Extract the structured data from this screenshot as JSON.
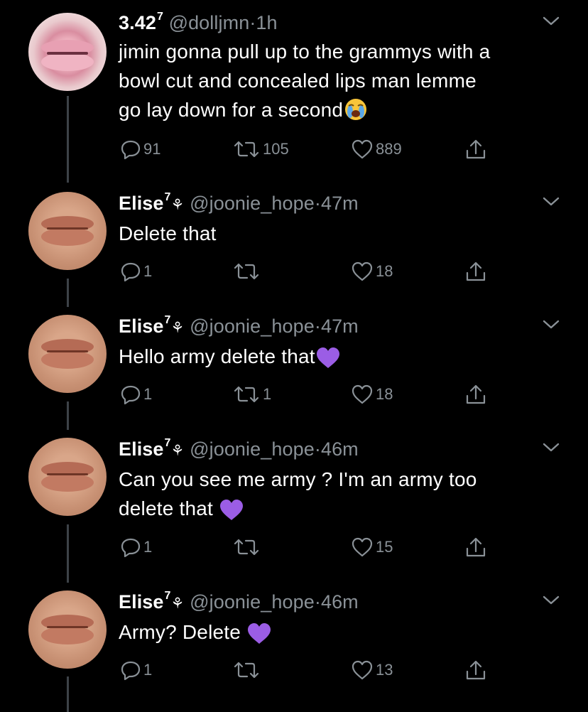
{
  "tweets": [
    {
      "name": "3.42",
      "sup": "7",
      "handle": "@dolljmn",
      "dot": "·",
      "time": "1h",
      "lines": [
        "jimin gonna pull up to the grammys with a",
        "bowl cut and concealed lips man lemme",
        "go lay down for a second"
      ],
      "trailing_emoji": "crying-face-emoji",
      "replies": "91",
      "retweets": "105",
      "likes": "889",
      "avatar": "pink-lips-avatar"
    },
    {
      "name": "Elise",
      "sup": "7",
      "flower": "⚘",
      "handle": "@joonie_hope",
      "dot": "·",
      "time": "47m",
      "lines": [
        "Delete that"
      ],
      "replies": "1",
      "retweets": "",
      "likes": "18",
      "avatar": "lips-avatar"
    },
    {
      "name": "Elise",
      "sup": "7",
      "flower": "⚘",
      "handle": "@joonie_hope",
      "dot": "·",
      "time": "47m",
      "lines": [
        "Hello army delete that"
      ],
      "trailing_emoji": "purple-heart-emoji",
      "replies": "1",
      "retweets": "1",
      "likes": "18",
      "avatar": "lips-avatar"
    },
    {
      "name": "Elise",
      "sup": "7",
      "flower": "⚘",
      "handle": "@joonie_hope",
      "dot": "·",
      "time": "46m",
      "lines": [
        "Can you see me army ? I'm an army too",
        "delete that "
      ],
      "trailing_emoji": "purple-heart-emoji",
      "replies": "1",
      "retweets": "",
      "likes": "15",
      "avatar": "lips-avatar"
    },
    {
      "name": "Elise",
      "sup": "7",
      "flower": "⚘",
      "handle": "@joonie_hope",
      "dot": "·",
      "time": "46m",
      "lines": [
        "Army? Delete "
      ],
      "trailing_emoji": "purple-heart-emoji",
      "replies": "1",
      "retweets": "",
      "likes": "13",
      "avatar": "lips-avatar"
    }
  ],
  "colors": {
    "background": "#000000",
    "secondary": "#8a9197",
    "purple_heart": "#9b5de5",
    "thread_line": "#3d4248"
  }
}
